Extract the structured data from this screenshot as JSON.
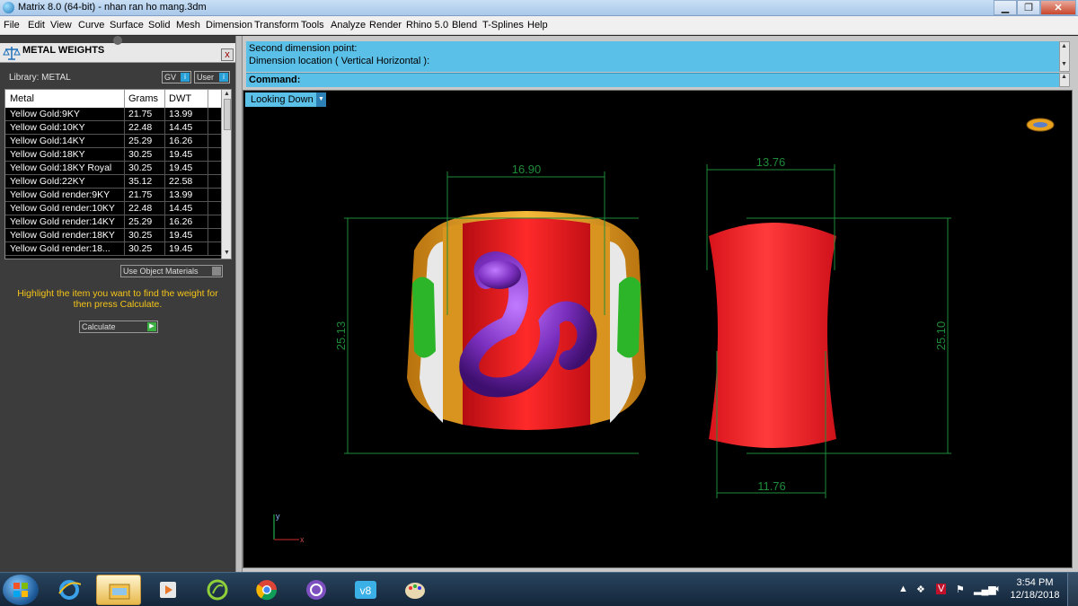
{
  "window": {
    "title": "Matrix 8.0 (64-bit) - nhan ran ho mang.3dm",
    "minimize": "▁",
    "maximize": "❐",
    "close": "✕"
  },
  "menu": [
    "File",
    "Edit",
    "View",
    "Curve",
    "Surface",
    "Solid",
    "Mesh",
    "Dimension",
    "Transform",
    "Tools",
    "Analyze",
    "Render",
    "Rhino 5.0",
    "Blend",
    "T-Splines",
    "Help"
  ],
  "panel": {
    "title": "METAL WEIGHTS",
    "close": "x",
    "library_label": "Library: METAL",
    "gv_label": "GV",
    "user_label": "User",
    "toggle_glyph": "i",
    "columns": [
      "Metal",
      "Grams",
      "DWT"
    ],
    "rows": [
      {
        "metal": "Yellow Gold:9KY",
        "grams": "21.75",
        "dwt": "13.99"
      },
      {
        "metal": "Yellow Gold:10KY",
        "grams": "22.48",
        "dwt": "14.45"
      },
      {
        "metal": "Yellow Gold:14KY",
        "grams": "25.29",
        "dwt": "16.26"
      },
      {
        "metal": "Yellow Gold:18KY",
        "grams": "30.25",
        "dwt": "19.45"
      },
      {
        "metal": "Yellow Gold:18KY Royal",
        "grams": "30.25",
        "dwt": "19.45"
      },
      {
        "metal": "Yellow Gold:22KY",
        "grams": "35.12",
        "dwt": "22.58"
      },
      {
        "metal": "Yellow Gold render:9KY",
        "grams": "21.75",
        "dwt": "13.99"
      },
      {
        "metal": "Yellow Gold render:10KY",
        "grams": "22.48",
        "dwt": "14.45"
      },
      {
        "metal": "Yellow Gold render:14KY",
        "grams": "25.29",
        "dwt": "16.26"
      },
      {
        "metal": "Yellow Gold render:18KY",
        "grams": "30.25",
        "dwt": "19.45"
      },
      {
        "metal": "Yellow Gold render:18...",
        "grams": "30.25",
        "dwt": "19.45"
      }
    ],
    "use_object_materials": "Use Object Materials",
    "hint": "Highlight the item you want to find the weight for then press Calculate.",
    "calculate": "Calculate",
    "calculate_glyph": "▶"
  },
  "command": {
    "history_line1": "Second dimension point:",
    "history_line2": "Dimension location ( Vertical  Horizontal ):",
    "prompt": "Command:"
  },
  "viewport": {
    "view_name": "Looking Down",
    "view_arrow": "▼",
    "dimensions": {
      "front_width": "16.90",
      "front_height": "25.13",
      "side_top_width": "13.76",
      "side_height": "25.10",
      "side_bottom_width": "11.76"
    },
    "axis_y": "y",
    "axis_x": "x"
  },
  "taskbar": {
    "clock_time": "3:54 PM",
    "clock_date": "12/18/2018",
    "apps": [
      "internet-explorer",
      "file-explorer",
      "media-player",
      "matrix-app",
      "chrome",
      "viber",
      "v8",
      "paint"
    ]
  },
  "colors": {
    "accent": "#5bc0e8",
    "dimension": "#1e8c3a",
    "ring_red": "#e5121a",
    "gold": "#e8a21d",
    "snake": "#7b2fbe"
  }
}
